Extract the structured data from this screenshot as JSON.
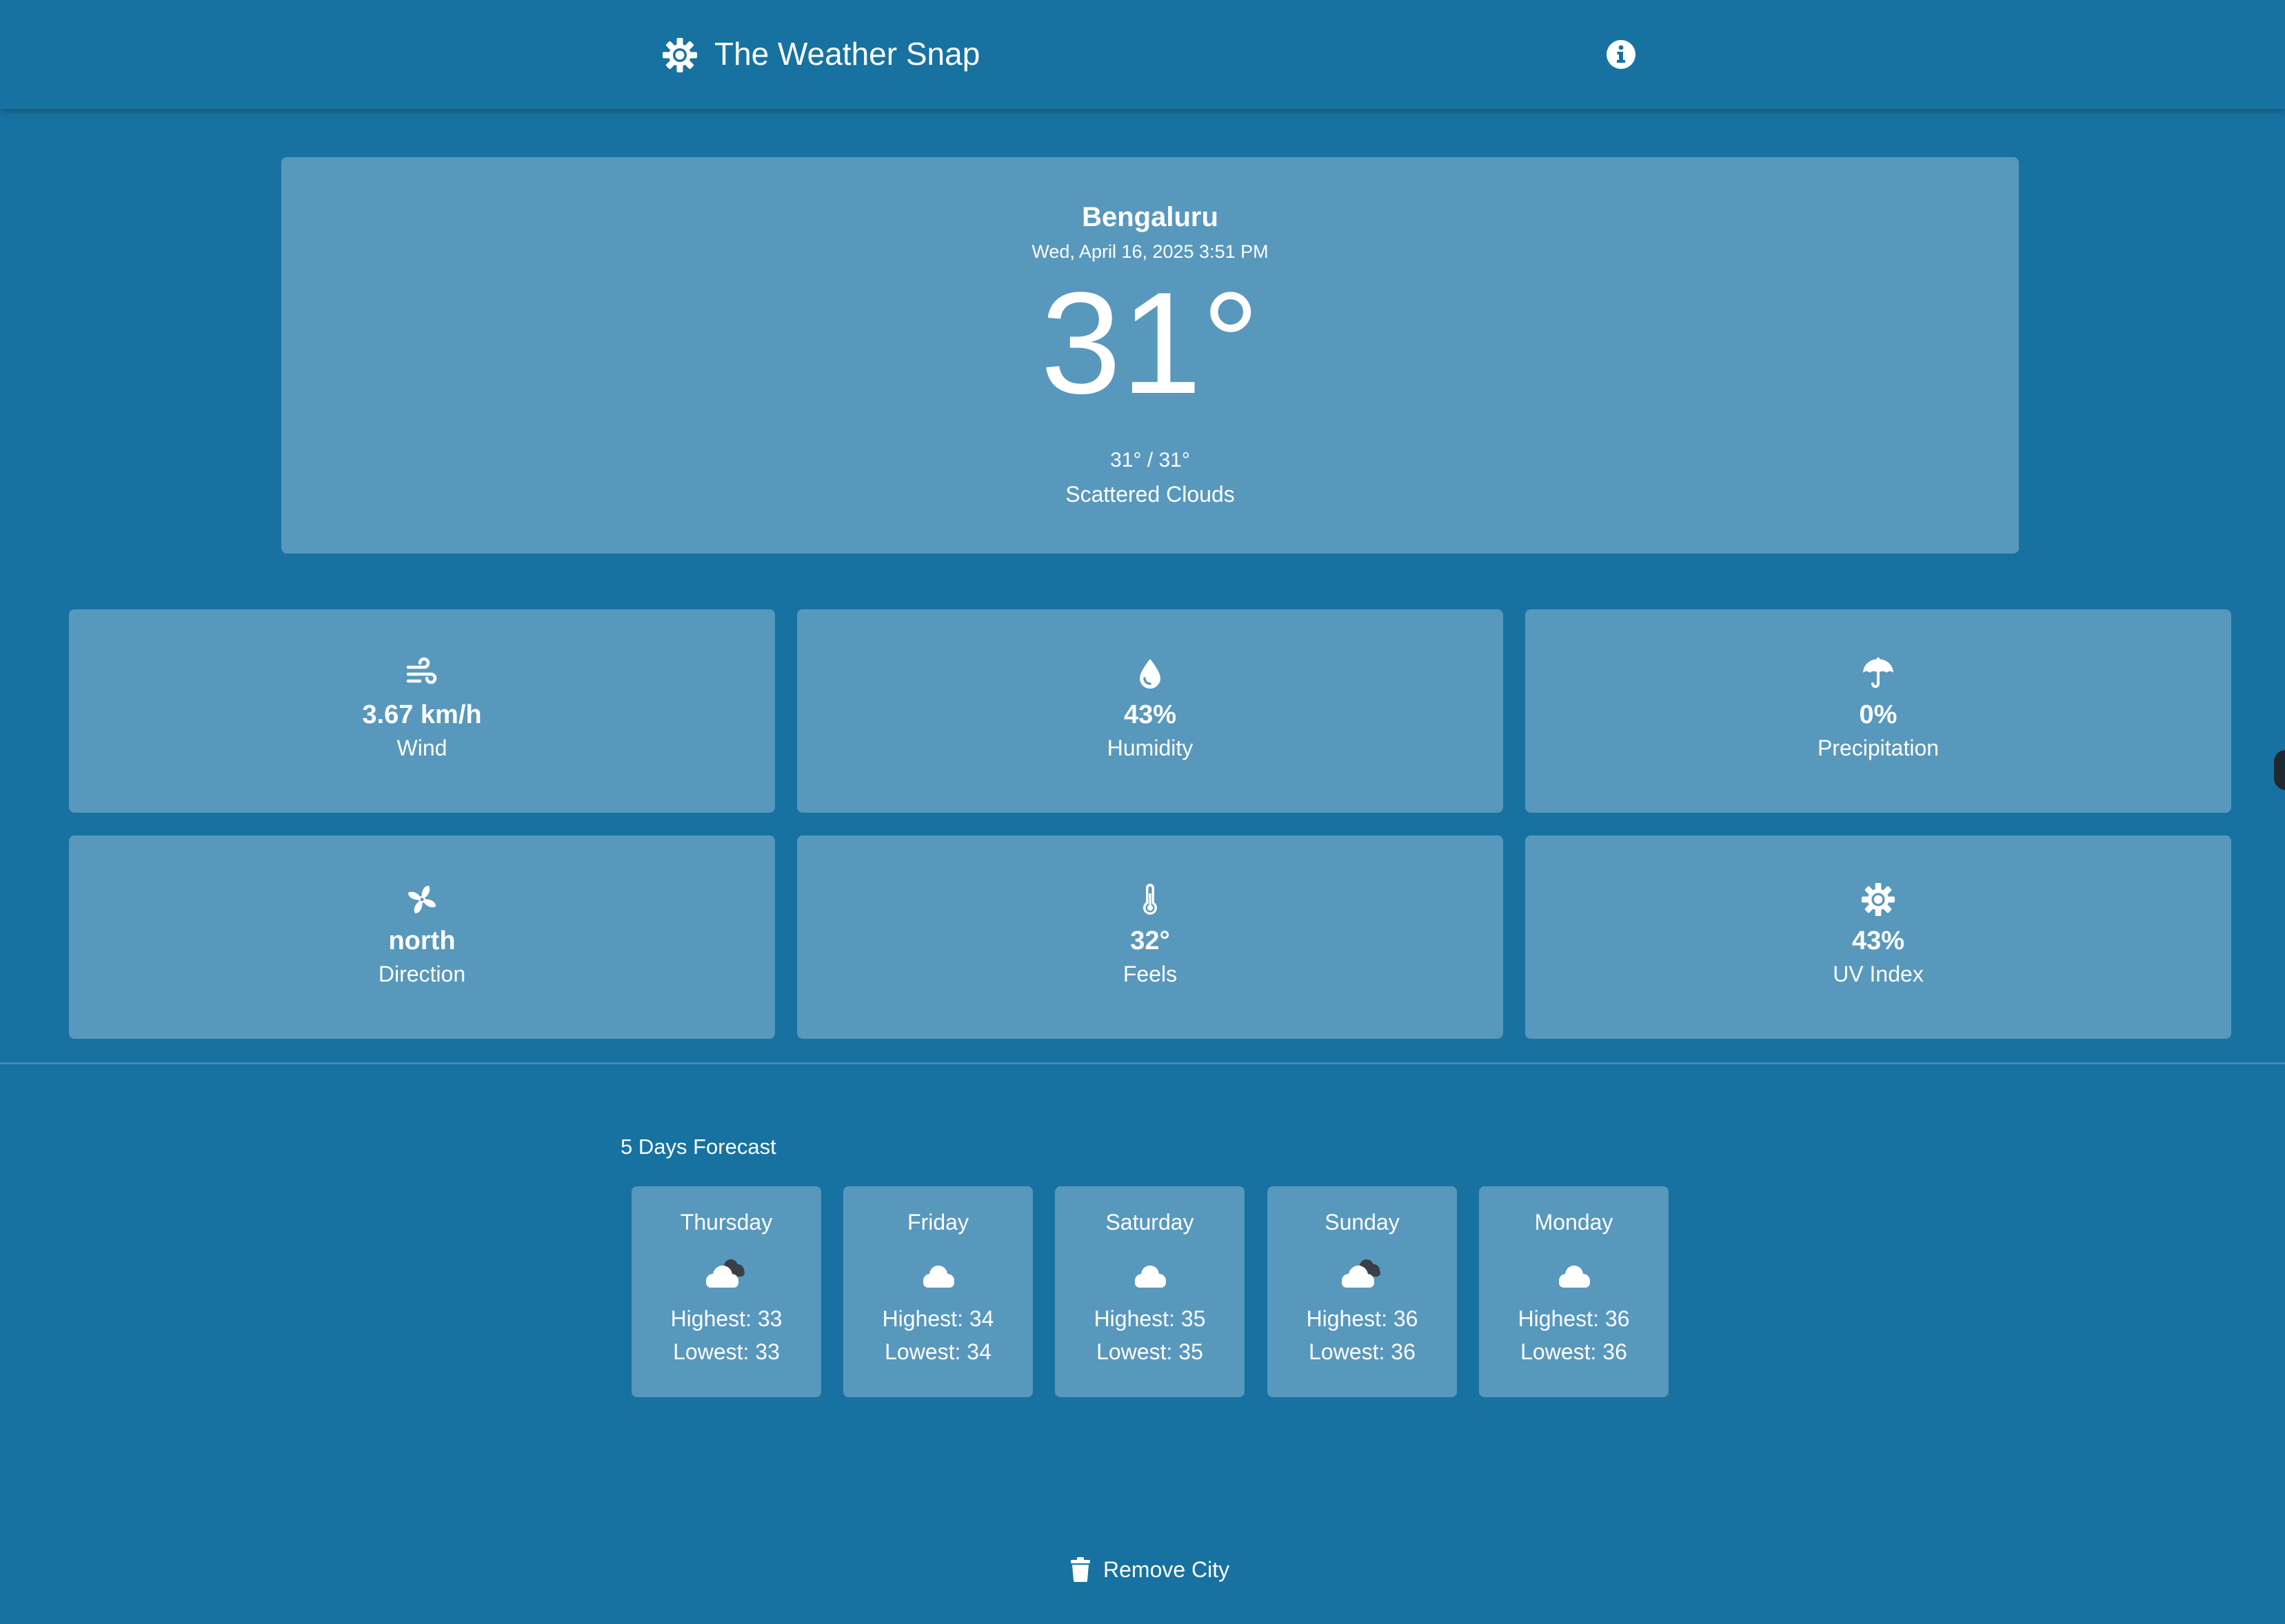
{
  "header": {
    "title": "The Weather Snap",
    "logo_icon": "sun-gear-icon",
    "info_icon": "info-circle-icon"
  },
  "current": {
    "city": "Bengaluru",
    "datetime": "Wed, April 16, 2025 3:51 PM",
    "temperature": "31°",
    "range": "31° / 31°",
    "condition": "Scattered Clouds"
  },
  "stats": {
    "wind": {
      "value": "3.67 km/h",
      "label": "Wind",
      "icon": "wind-icon"
    },
    "humidity": {
      "value": "43%",
      "label": "Humidity",
      "icon": "water-drop-icon"
    },
    "precipitation": {
      "value": "0%",
      "label": "Precipitation",
      "icon": "umbrella-icon"
    },
    "direction": {
      "value": "north",
      "label": "Direction",
      "icon": "fan-icon"
    },
    "feels": {
      "value": "32°",
      "label": "Feels",
      "icon": "thermometer-icon"
    },
    "uv": {
      "value": "43%",
      "label": "UV Index",
      "icon": "sun-icon"
    }
  },
  "forecast": {
    "title": "5 Days Forecast",
    "days": [
      {
        "name": "Thursday",
        "high": "Highest: 33",
        "low": "Lowest: 33",
        "icon": "cloud-dark-icon"
      },
      {
        "name": "Friday",
        "high": "Highest: 34",
        "low": "Lowest: 34",
        "icon": "cloud-icon"
      },
      {
        "name": "Saturday",
        "high": "Highest: 35",
        "low": "Lowest: 35",
        "icon": "cloud-icon"
      },
      {
        "name": "Sunday",
        "high": "Highest: 36",
        "low": "Lowest: 36",
        "icon": "cloud-dark-icon"
      },
      {
        "name": "Monday",
        "high": "Highest: 36",
        "low": "Lowest: 36",
        "icon": "cloud-icon"
      }
    ]
  },
  "actions": {
    "remove_label": "Remove City",
    "remove_icon": "trash-icon"
  },
  "colors": {
    "background": "#1772a1",
    "card": "#5898bd",
    "text": "#ffffff",
    "dark_cloud": "#3a3f45"
  }
}
